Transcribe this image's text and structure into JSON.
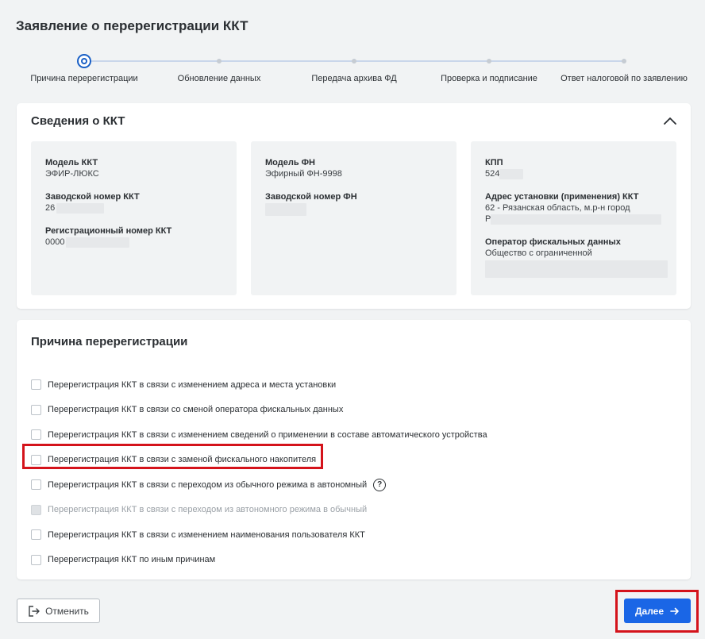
{
  "page": {
    "title": "Заявление о перерегистрации ККТ"
  },
  "stepper": {
    "steps": [
      {
        "label": "Причина перерегистрации",
        "active": true
      },
      {
        "label": "Обновление данных",
        "active": false
      },
      {
        "label": "Передача архива ФД",
        "active": false
      },
      {
        "label": "Проверка и подписание",
        "active": false
      },
      {
        "label": "Ответ налоговой по заявлению",
        "active": false
      }
    ]
  },
  "kkt_info": {
    "title": "Сведения о ККТ",
    "panel1": {
      "model_label": "Модель ККТ",
      "model_value": "ЭФИР-ЛЮКС",
      "serial_label": "Заводской номер ККТ",
      "serial_value": "26",
      "regnum_label": "Регистрационный номер ККТ",
      "regnum_value": "0000"
    },
    "panel2": {
      "fn_model_label": "Модель ФН",
      "fn_model_value": "Эфирный ФН-9998",
      "fn_serial_label": "Заводской номер ФН"
    },
    "panel3": {
      "kpp_label": "КПП",
      "kpp_value": "524",
      "address_label": "Адрес установки (применения) ККТ",
      "address_value": "62 - Рязанская область, м.р-н город",
      "address_line2": "Р",
      "ofd_label": "Оператор фискальных данных",
      "ofd_value": "Общество с ограниченной"
    }
  },
  "reasons": {
    "title": "Причина перерегистрации",
    "items": [
      {
        "label": "Перерегистрация ККТ в связи с изменением адреса и места установки",
        "disabled": false,
        "help": false
      },
      {
        "label": "Перерегистрация ККТ в связи со сменой оператора фискальных данных",
        "disabled": false,
        "help": false
      },
      {
        "label": "Перерегистрация ККТ в связи с изменением сведений о применении в составе автоматического устройства",
        "disabled": false,
        "help": false
      },
      {
        "label": "Перерегистрация ККТ в связи с заменой фискального накопителя",
        "disabled": false,
        "help": false
      },
      {
        "label": "Перерегистрация ККТ в связи с переходом из обычного режима в автономный",
        "disabled": false,
        "help": true
      },
      {
        "label": "Перерегистрация ККТ в связи с переходом из автономного режима в обычный",
        "disabled": true,
        "help": false
      },
      {
        "label": "Перерегистрация ККТ в связи с изменением наименования пользователя ККТ",
        "disabled": false,
        "help": false
      },
      {
        "label": "Перерегистрация ККТ по иным причинам",
        "disabled": false,
        "help": false
      }
    ],
    "help_glyph": "?"
  },
  "footer": {
    "cancel_label": "Отменить",
    "next_label": "Далее"
  },
  "colors": {
    "accent": "#1a66e6",
    "highlight": "#d4131b",
    "background": "#f1f3f4"
  }
}
